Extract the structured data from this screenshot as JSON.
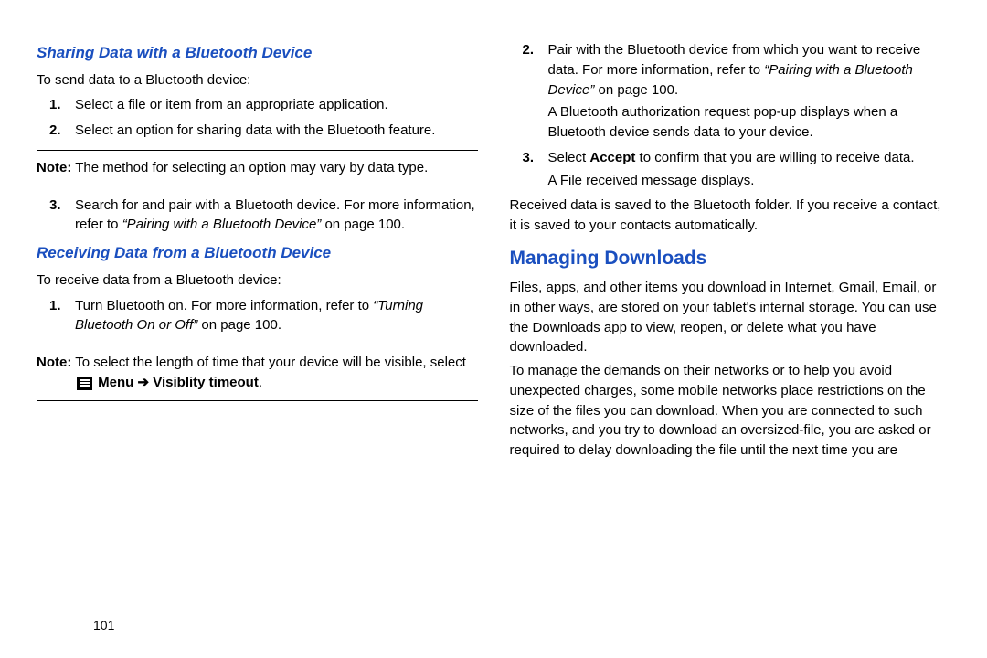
{
  "left": {
    "sharing": {
      "heading": "Sharing Data with a Bluetooth Device",
      "intro": "To send data to a Bluetooth device:",
      "step1": "Select a file or item from an appropriate application.",
      "step2": "Select an option for sharing data with the Bluetooth feature.",
      "note1_label": "Note:",
      "note1_body": "The method for selecting an option may vary by data type.",
      "step3_a": "Search for and pair with a Bluetooth device. For more information, refer to ",
      "step3_ref": "“Pairing with a Bluetooth Device”",
      "step3_b": " on page 100."
    },
    "receiving": {
      "heading": "Receiving Data from a Bluetooth Device",
      "intro": "To receive data from a Bluetooth device:",
      "step1_a": "Turn Bluetooth on. For more information, refer to ",
      "step1_ref": "“Turning Bluetooth On or Off”",
      "step1_b": " on page 100.",
      "note2_label": "Note:",
      "note2_a": "To select the length of time that your device will be visible, select ",
      "note2_menu": "Menu",
      "note2_arrow": " ➔ ",
      "note2_vis": "Visiblity timeout",
      "note2_end": "."
    },
    "pagenum": "101"
  },
  "right": {
    "step2_a": "Pair with the Bluetooth device from which you want to receive data. For more information, refer to ",
    "step2_ref": "“Pairing with a Bluetooth Device”",
    "step2_b": " on page 100.",
    "step2_sub": "A Bluetooth authorization request pop-up displays when a Bluetooth device sends data to your device.",
    "step3_a": "Select ",
    "step3_accept": "Accept",
    "step3_b": " to confirm that you are willing to receive data.",
    "step3_sub": "A File received message displays.",
    "para_received": "Received data is saved to the Bluetooth folder. If you receive a contact, it is saved to your contacts automatically.",
    "managing": {
      "heading": "Managing Downloads",
      "p1": "Files, apps, and other items you download in Internet, Gmail, Email, or in other ways, are stored on your tablet's internal storage. You can use the Downloads app to view, reopen, or delete what you have downloaded.",
      "p2": "To manage the demands on their networks or to help you avoid unexpected charges, some mobile networks place restrictions on the size of the files you can download. When you are connected to such networks, and you try to download an oversized-file, you are asked or required to delay downloading the file until the next time you are"
    }
  }
}
